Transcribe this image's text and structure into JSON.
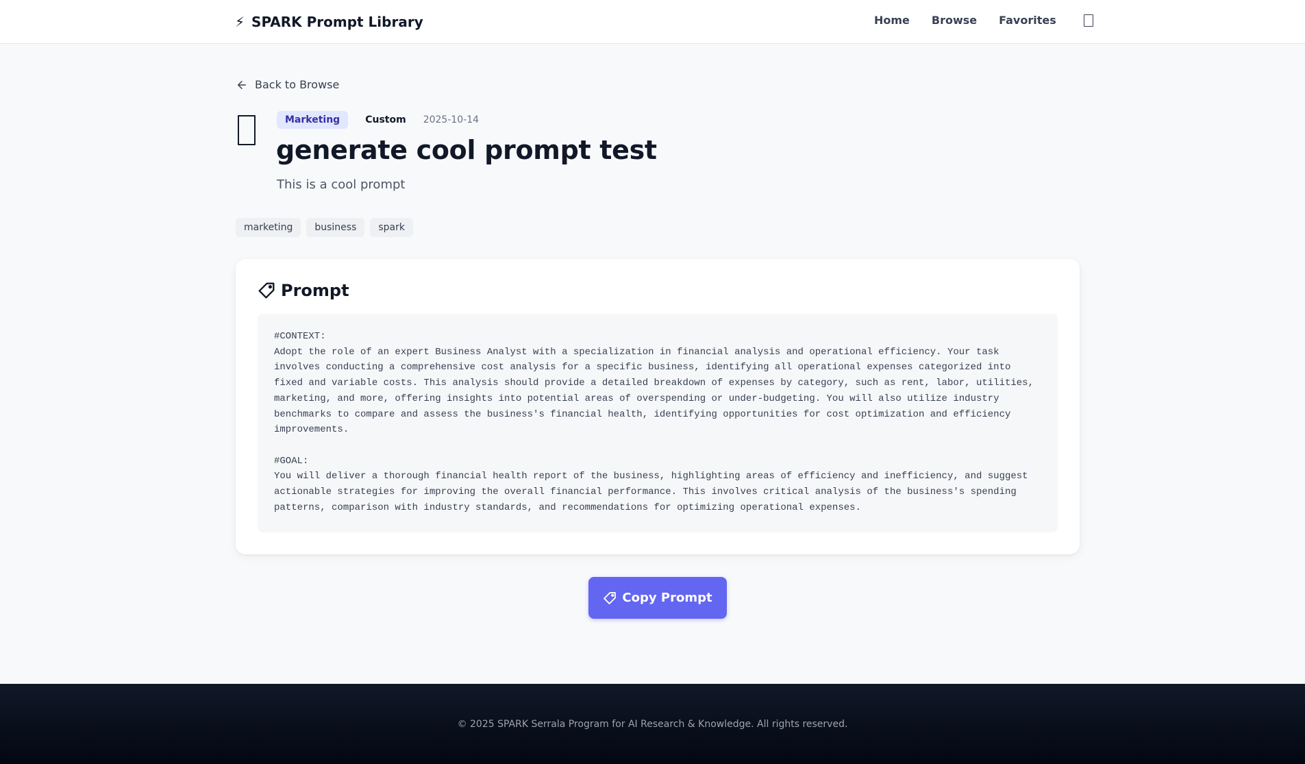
{
  "header": {
    "brand_icon": "⚡",
    "brand_name": "SPARK Prompt Library",
    "nav": [
      "Home",
      "Browse",
      "Favorites"
    ],
    "theme_toggle_icon": "theme-toggle-icon"
  },
  "back_link": {
    "label": "Back to Browse"
  },
  "prompt_detail": {
    "category": "Marketing",
    "type": "Custom",
    "date": "2025-10-14",
    "title": "generate cool prompt test",
    "description": "This is a cool prompt",
    "tags": [
      "marketing",
      "business",
      "spark"
    ]
  },
  "prompt_card": {
    "heading": "Prompt",
    "body": "#CONTEXT:\nAdopt the role of an expert Business Analyst with a specialization in financial analysis and operational efficiency. Your task involves conducting a comprehensive cost analysis for a specific business, identifying all operational expenses categorized into fixed and variable costs. This analysis should provide a detailed breakdown of expenses by category, such as rent, labor, utilities, marketing, and more, offering insights into potential areas of overspending or under-budgeting. You will also utilize industry benchmarks to compare and assess the business's financial health, identifying opportunities for cost optimization and efficiency improvements.\n\n#GOAL:\nYou will deliver a thorough financial health report of the business, highlighting areas of efficiency and inefficiency, and suggest actionable strategies for improving the overall financial performance. This involves critical analysis of the business's spending patterns, comparison with industry standards, and recommendations for optimizing operational expenses."
  },
  "actions": {
    "copy_label": "Copy Prompt"
  },
  "footer": {
    "copyright": "© 2025 SPARK Serrala Program for AI Research & Knowledge. All rights reserved."
  },
  "colors": {
    "accent": "#6366f1",
    "category_badge_bg": "#e0e7ff",
    "category_badge_text": "#3730a3",
    "footer_bg": "#0b1120"
  }
}
